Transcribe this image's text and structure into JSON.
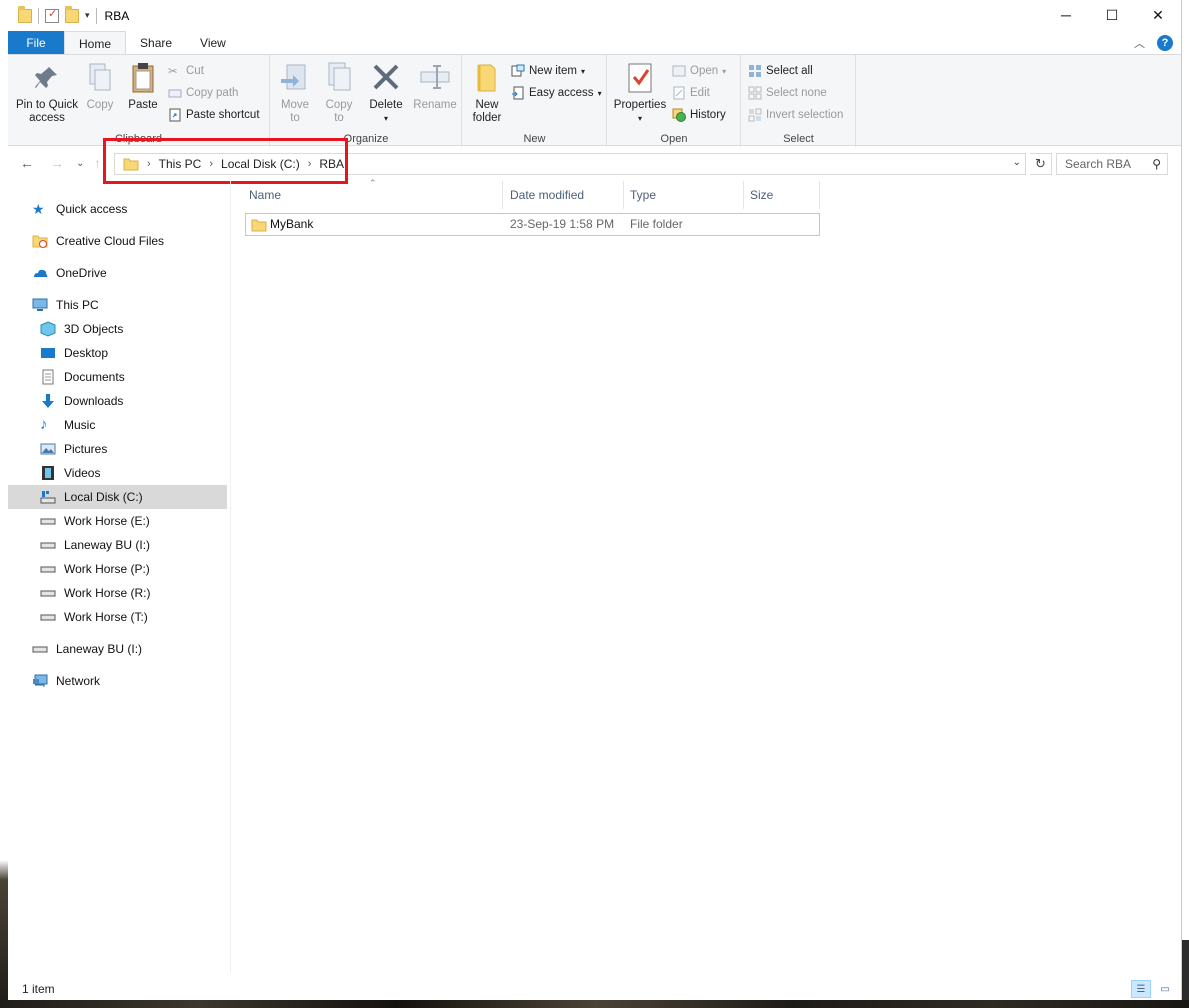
{
  "window": {
    "title": "RBA"
  },
  "controls": {
    "minimize": "─",
    "maximize": "☐",
    "close": "✕"
  },
  "tabs": [
    {
      "label": "File"
    },
    {
      "label": "Home"
    },
    {
      "label": "Share"
    },
    {
      "label": "View"
    }
  ],
  "ribbon": {
    "clipboard": {
      "label": "Clipboard",
      "pin": "Pin to Quick access",
      "pin_line1": "Pin to Quick",
      "pin_line2": "access",
      "copy": "Copy",
      "paste": "Paste",
      "cut": "Cut",
      "copy_path": "Copy path",
      "paste_shortcut": "Paste shortcut"
    },
    "organize": {
      "label": "Organize",
      "move_to_line1": "Move",
      "move_to_line2": "to",
      "copy_to_line1": "Copy",
      "copy_to_line2": "to",
      "delete": "Delete",
      "rename": "Rename"
    },
    "new": {
      "label": "New",
      "new_folder_line1": "New",
      "new_folder_line2": "folder",
      "new_item": "New item",
      "easy_access": "Easy access"
    },
    "open": {
      "label": "Open",
      "properties": "Properties",
      "open": "Open",
      "edit": "Edit",
      "history": "History"
    },
    "select": {
      "label": "Select",
      "select_all": "Select all",
      "select_none": "Select none",
      "invert_selection": "Invert selection"
    }
  },
  "address": {
    "crumbs": [
      "This PC",
      "Local Disk (C:)",
      "RBA"
    ],
    "search_placeholder": "Search RBA"
  },
  "nav": {
    "quick_access": "Quick access",
    "creative_cloud": "Creative Cloud Files",
    "onedrive": "OneDrive",
    "this_pc": "This PC",
    "items": [
      "3D Objects",
      "Desktop",
      "Documents",
      "Downloads",
      "Music",
      "Pictures",
      "Videos",
      "Local Disk (C:)",
      "Work Horse (E:)",
      "Laneway BU (I:)",
      "Work Horse (P:)",
      "Work Horse (R:)",
      "Work Horse (T:)"
    ],
    "laneway": "Laneway BU (I:)",
    "network": "Network"
  },
  "columns": {
    "name": "Name",
    "date": "Date modified",
    "type": "Type",
    "size": "Size"
  },
  "files": [
    {
      "name": "MyBank",
      "date": "23-Sep-19 1:58 PM",
      "type": "File folder",
      "size": ""
    }
  ],
  "status": {
    "count": "1 item"
  }
}
